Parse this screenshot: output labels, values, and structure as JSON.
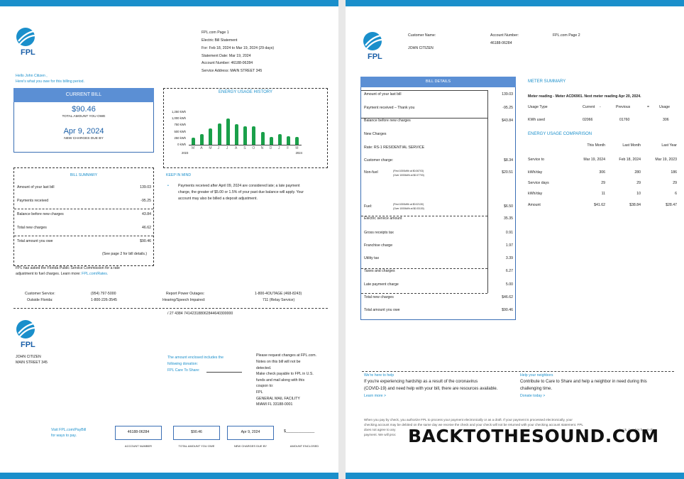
{
  "page1": {
    "header": {
      "line1": "FPL.com   Page 1",
      "line2": "Electric Bill Statement",
      "line3": "For:  Feb 18, 2024 to Mar 19, 2024 (29 days)",
      "line4": "Statement Date:  Mar 19, 2024",
      "line5": "Account Number:  46188-06284",
      "line6": "Service Address: MAIN STREET 345"
    },
    "greeting": {
      "line1": "Hello John Citizen ,",
      "line2": "Here's what you owe for this billing period."
    },
    "current_bill": {
      "title": "CURRENT BILL",
      "amount": "$90.46",
      "amount_label": "TOTAL AMOUNT YOU OWE",
      "due_date": "Apr 9, 2024",
      "due_label": "NEW CHARGES DUE BY"
    },
    "chart_data": {
      "type": "bar",
      "title": "ENERGY USAGE HISTORY",
      "categories": [
        "M",
        "A",
        "M",
        "J",
        "J",
        "A",
        "S",
        "O",
        "N",
        "D",
        "J",
        "F",
        "M"
      ],
      "values": [
        280,
        420,
        620,
        820,
        1000,
        800,
        700,
        720,
        480,
        300,
        400,
        320,
        300
      ],
      "y_ticks": [
        "1,250 kWh",
        "1,000 kWh",
        "750 kWh",
        "500 kWh",
        "250 kWh",
        "0 kWh"
      ],
      "ylim": [
        0,
        1250
      ],
      "x_start_year": "2023",
      "x_end_year": "2024"
    },
    "summary": {
      "title": "BILL SUMMARY",
      "rows": [
        {
          "label": "Amount of your last bill",
          "value": "139.03"
        },
        {
          "label": "Payments received",
          "value": "-95.25"
        },
        {
          "label": "Balance before new charges",
          "value": "43.84"
        },
        {
          "label": "Total new charges",
          "value": "46.62"
        },
        {
          "label": "Total amount you owe",
          "value": "$90.46"
        }
      ],
      "note": "(See page 2 for bill details.)"
    },
    "keep": {
      "title": "KEEP IN MIND",
      "line1": "Payments received after April 09, 2024 are considered late; a late payment",
      "line2": "charge, the greater of $5.00 or 1.5% of your past due balance will apply. Your",
      "line3": "account may also be billed a deposit adjustment."
    },
    "psc": {
      "line1": "FPL has asked the Florida Public Service Commission for a rate",
      "line2": "adjustment to fuel charges. Learn more:",
      "link": "FPL.com/Rates."
    },
    "contacts": {
      "cs_label": "Customer Service:",
      "cs_num": "(954) 797-5000",
      "of_label": "Outside Florida:",
      "of_num": "1-800-226-3545",
      "ro_label": "Report Power Outages:",
      "ro_num": "1-800-4OUTAGE (468-8243)",
      "hs_label": "Hearing/Speech Impaired:",
      "hs_num": "711 (Relay Service)"
    },
    "barcode_line": "/ 27 4384 741423188062844640300000",
    "stub": {
      "name": "JOHN CITIZEN",
      "street": "MAIN STREET 345",
      "donation1": "The amount enclosed includes the",
      "donation2": "following donation:",
      "donation3": "FPL Care To Share:",
      "req1": "Please request changes at FPL.com.",
      "req2": "Notes on this bill will not be",
      "req3": "detected.",
      "req4": "Make check payable to FPL in U.S.",
      "req5": "funds and mail along with this",
      "req6": "coupon to:",
      "req7": "FPL",
      "req8": "GENERAL MAIL FACILITY",
      "req9": "MIAMI FL 33188-0001",
      "visit1": "Visit FPL.com/PayBill",
      "visit2": "for ways to pay.",
      "acct": "46188-06284",
      "acct_label": "ACCOUNT NUMBER",
      "total": "$90.46",
      "total_label": "TOTAL AMOUNT YOU OWE",
      "due": "Apr 9, 2024",
      "due_label": "NEW CHARGES DUE BY",
      "enclosed": "$______________",
      "enclosed_label": "AMOUNT ENCLOSED"
    },
    "logo_text": "FPL"
  },
  "page2": {
    "cust_label": "Customer Name:",
    "cust_name": "JOHN CITIZEN",
    "acct_label": "Account Number:",
    "acct": "46188-06284",
    "page": "FPL.com Page 2",
    "details": {
      "title": "BILL DETAILS",
      "rows": [
        {
          "label": "Amount of your last bill",
          "value": "139.03"
        },
        {
          "label": "Payment received – Thank you",
          "value": "-95.25"
        },
        {
          "label": "Balance before new charges",
          "value": "$43.84"
        },
        {
          "label": "New Charges",
          "value": ""
        },
        {
          "label": "Rate: RS-1 RESIDENTIAL SERVICE",
          "value": ""
        },
        {
          "label": "Customer charge:",
          "value": "$8.34"
        },
        {
          "label": "Non-fuel",
          "value": "$20.51"
        },
        {
          "label": "Fuel:",
          "value": "$6.50"
        },
        {
          "label": "Electric service amount",
          "value": "35.35"
        },
        {
          "label": "Gross receipts tax",
          "value": "0.91"
        },
        {
          "label": "Franchise charge",
          "value": "1.97"
        },
        {
          "label": "Utility tax",
          "value": "3.39"
        },
        {
          "label": "Taxes and charges",
          "value": "6.27"
        },
        {
          "label": "Late payment charge",
          "value": "5.00"
        },
        {
          "label": "Total new charges",
          "value": "$46.62"
        },
        {
          "label": "Total amount you owe",
          "value": "$90.46"
        }
      ],
      "nonfuel_a": "(First 1000kWh at $0.06703)",
      "nonfuel_b": "(Over 1000kWh at $0.07703)",
      "fuel_a": "(First 1000kWh at $0.02130)",
      "fuel_b": "(Over 1000kWh at $0.03130)"
    },
    "meter": {
      "title": "METER SUMMARY",
      "reading": "Meter reading - Meter ACD6901. Next meter reading Apr 20, 2024.",
      "headers": [
        "Usage Type",
        "Current",
        "-",
        "Previous",
        "=",
        "Usage"
      ],
      "row": [
        "KWh used",
        "02066",
        "",
        "01760",
        "",
        "306"
      ]
    },
    "comparison": {
      "title": "ENERGY USAGE COMPARISON",
      "headers": [
        "",
        "This Month",
        "Last Month",
        "Last Year"
      ],
      "rows": [
        [
          "Service to",
          "Mar 19, 2024",
          "Feb 18, 2024",
          "Mar 19, 2023"
        ],
        [
          "kWh/day",
          "306",
          "280",
          "186"
        ],
        [
          "Service days",
          "29",
          "29",
          "29"
        ],
        [
          "kWh/day",
          "11",
          "10",
          "6"
        ],
        [
          "Amount",
          "$41.62",
          "$38.84",
          "$28.47"
        ]
      ]
    },
    "help": {
      "h1": "We're here to help",
      "p1": "If you're experiencing hardship as a result of the coronavirus",
      "p2": "(COVID-19) and need help with your bill, there are resources available.",
      "l1": "Learn more >",
      "h2": "Help your neighbors",
      "q1": "Contribute to Care to Share and help a neighbor in need during this",
      "q2": "challenging time.",
      "l2": "Donate today >"
    },
    "footer": {
      "f1": "When you pay by check, you authorize FPL to process your payment electronically or as a draft. If your payment is processed electronically, your",
      "f2": "checking account may be debited on the same day we receive the check and your check will not be returned with your checking account statement. FPL",
      "f3": "does not agree to any",
      "f3b": "check, or other forms of",
      "f4": "payment. We will proc"
    },
    "watermark": "BACKTOTHESOUND.COM",
    "logo_text": "FPL"
  }
}
